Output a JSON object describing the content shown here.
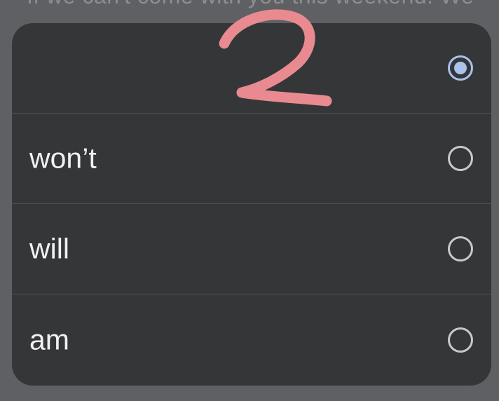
{
  "background": {
    "partial_sentence": "If we can't come with you this weekend. We"
  },
  "options": [
    {
      "label": "",
      "selected": true
    },
    {
      "label": "won’t",
      "selected": false
    },
    {
      "label": "will",
      "selected": false
    },
    {
      "label": "am",
      "selected": false
    }
  ],
  "annotation": {
    "text": "2",
    "color": "#e98a91"
  },
  "colors": {
    "sheet_background": "#353638",
    "page_background": "#5f6063",
    "radio_selected": "#a9c2ee",
    "radio_unselected": "#c9c9cb",
    "divider": "#4f5053"
  }
}
